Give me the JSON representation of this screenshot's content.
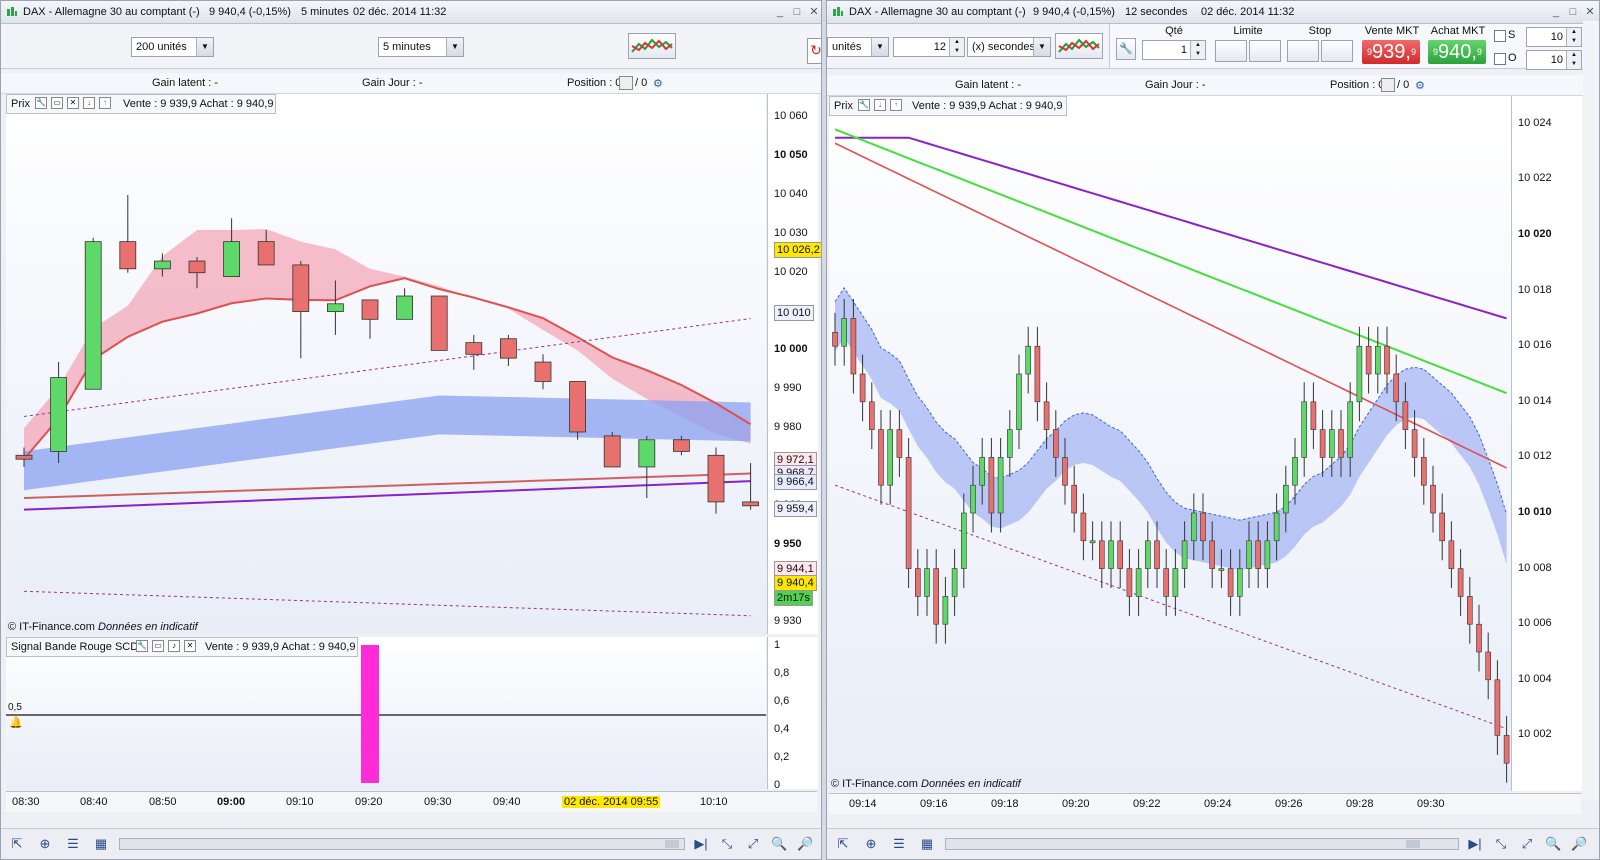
{
  "colors": {
    "up": "#5fd86a",
    "down": "#e8706f",
    "purple": "#8a22c8",
    "green_ma": "#44e03a",
    "red_ma": "#e05050",
    "blue_band": "#8aa0f0",
    "pink_band": "#f3a3b4",
    "magenta": "#ff2bd6",
    "yellow_tag": "#ffe800"
  },
  "left": {
    "title": {
      "name": "DAX - Allemagne 30 au comptant (-)",
      "quote": "9 940,4 (-0,15%)",
      "period": "5 minutes",
      "date": "02 déc. 2014 11:32"
    },
    "toolbar": {
      "units": "200 unités",
      "period": "5 minutes"
    },
    "info": {
      "gain_latent": "Gain latent : -",
      "gain_jour": "Gain Jour : -",
      "position": "Position : 0",
      "pos2": "/ 0"
    },
    "legend_prix": {
      "name": "Prix",
      "quote": "Vente : 9 939,9 Achat : 9 940,9"
    },
    "legend_signal": {
      "name": "Signal Bande Rouge SCD",
      "quote": "Vente : 9 939,9 Achat : 9 940,9"
    },
    "copyright": {
      "source": "© IT-Finance.com",
      "note": "Données en indicatif"
    },
    "price_labels": [
      "10 060",
      "10 050",
      "10 040",
      "10 030",
      "10 020",
      "10 010",
      "10 000",
      "9 990",
      "9 980",
      "9 970",
      "9 960",
      "9 950",
      "9 940",
      "9 930"
    ],
    "tags": [
      {
        "text": "10 026,2",
        "bg": "#ffe800"
      },
      {
        "text": "10 010",
        "bg": "#eef0ff"
      },
      {
        "text": "9 972,1",
        "bg": "#ffe6ea"
      },
      {
        "text": "9 968,7",
        "bg": "#f0e6ff"
      },
      {
        "text": "9 966,4",
        "bg": "#e6ecff"
      },
      {
        "text": "9 959,4",
        "bg": "#eef0ff"
      },
      {
        "text": "9 944,1",
        "bg": "#ffe6ea"
      },
      {
        "text": "9 940,4",
        "bg": "#ffe800"
      },
      {
        "text": "2m17s",
        "bg": "#52d052"
      }
    ],
    "signal_axis": [
      "1",
      "0,8",
      "0,6",
      "0,4",
      "0,2",
      "0"
    ],
    "signal_level": "0,5",
    "time_labels": [
      "08:30",
      "08:40",
      "08:50",
      "09:00",
      "09:10",
      "09:20",
      "09:30",
      "09:40",
      "10:10"
    ],
    "time_highlight": "02 déc. 2014 09:55",
    "chart_data": {
      "type": "candlestick",
      "x": [
        "08:30",
        "08:35",
        "08:40",
        "08:45",
        "08:50",
        "08:55",
        "09:00",
        "09:05",
        "09:10",
        "09:15",
        "09:20",
        "09:25",
        "09:30",
        "09:35",
        "09:40",
        "09:45",
        "09:50",
        "09:55",
        "10:00",
        "10:05",
        "10:10",
        "10:15"
      ],
      "candles": [
        [
          9973,
          9975,
          9970,
          9972
        ],
        [
          9974,
          9997,
          9971,
          9993
        ],
        [
          9990,
          10029,
          9990,
          10028
        ],
        [
          10028,
          10040,
          10020,
          10021
        ],
        [
          10021,
          10025,
          10019,
          10023
        ],
        [
          10023,
          10024,
          10016,
          10020
        ],
        [
          10019,
          10034,
          10019,
          10028
        ],
        [
          10028,
          10031,
          10022,
          10022
        ],
        [
          10022,
          10023,
          9998,
          10010
        ],
        [
          10010,
          10018,
          10004,
          10012
        ],
        [
          10013,
          10013,
          10003,
          10008
        ],
        [
          10008,
          10016,
          10008,
          10014
        ],
        [
          10014,
          10014,
          10000,
          10000
        ],
        [
          10002,
          10004,
          9995,
          9999
        ],
        [
          10003,
          10004,
          9996,
          9998
        ],
        [
          9997,
          9999,
          9990,
          9992
        ],
        [
          9992,
          9992,
          9977,
          9979
        ],
        [
          9978,
          9979,
          9970,
          9970
        ],
        [
          9970,
          9978,
          9962,
          9977
        ],
        [
          9977,
          9978,
          9973,
          9974
        ],
        [
          9973,
          9975,
          9958,
          9961
        ],
        [
          9961,
          9971,
          9959,
          9960
        ]
      ],
      "ylim": [
        9927,
        10066
      ]
    }
  },
  "right": {
    "title": {
      "name": "DAX - Allemagne 30 au comptant (-)",
      "quote": "9 940,4 (-0,15%)",
      "period": "12 secondes",
      "date": "02 déc. 2014 11:32"
    },
    "toolbar": {
      "units": "unités",
      "interval": "12",
      "interval_unit": "(x) secondes",
      "qty_label": "Qté",
      "qty": "1",
      "limit_label": "Limite",
      "stop_label": "Stop",
      "sell_label": "Vente MKT",
      "buy_label": "Achat MKT",
      "sell_price": "939,",
      "sell_prefix": "9",
      "sell_suffix": "9",
      "buy_price": "940,",
      "buy_prefix": "9",
      "buy_suffix": "9",
      "s_label": "S",
      "o_label": "O",
      "s_value": "10",
      "o_value": "10"
    },
    "info": {
      "gain_latent": "Gain latent : -",
      "gain_jour": "Gain Jour : -",
      "position": "Position : 0",
      "pos2": "/ 0"
    },
    "legend_prix": {
      "name": "Prix",
      "quote": "Vente : 9 939,9 Achat : 9 940,9"
    },
    "copyright": {
      "source": "© IT-Finance.com",
      "note": "Données en indicatif"
    },
    "price_labels": [
      "10 024",
      "10 022",
      "10 020",
      "10 018",
      "10 016",
      "10 014",
      "10 012",
      "10 010",
      "10 008",
      "10 006",
      "10 004",
      "10 002"
    ],
    "time_labels": [
      "09:14",
      "09:16",
      "09:18",
      "09:20",
      "09:22",
      "09:24",
      "09:26",
      "09:28",
      "09:30"
    ],
    "chart_data": {
      "type": "candlestick",
      "x_start": "09:13:36",
      "interval_seconds": 12,
      "closes": [
        10016,
        10017,
        10015,
        10014,
        10013,
        10011,
        10013,
        10012,
        10008,
        10007,
        10008,
        10006,
        10007,
        10008,
        10010,
        10011,
        10012,
        10010,
        10012,
        10013,
        10015,
        10016,
        10014,
        10013,
        10012,
        10011,
        10010,
        10009,
        10009,
        10008,
        10009,
        10008,
        10007,
        10008,
        10009,
        10008,
        10007,
        10008,
        10009,
        10010,
        10009,
        10008,
        10008,
        10007,
        10008,
        10009,
        10008,
        10009,
        10010,
        10011,
        10012,
        10014,
        10013,
        10012,
        10013,
        10012,
        10014,
        10016,
        10015,
        10016,
        10015,
        10014,
        10013,
        10012,
        10011,
        10010,
        10009,
        10008,
        10007,
        10006,
        10005,
        10004,
        10002,
        10001
      ],
      "ylim": [
        10000,
        10025
      ]
    }
  }
}
